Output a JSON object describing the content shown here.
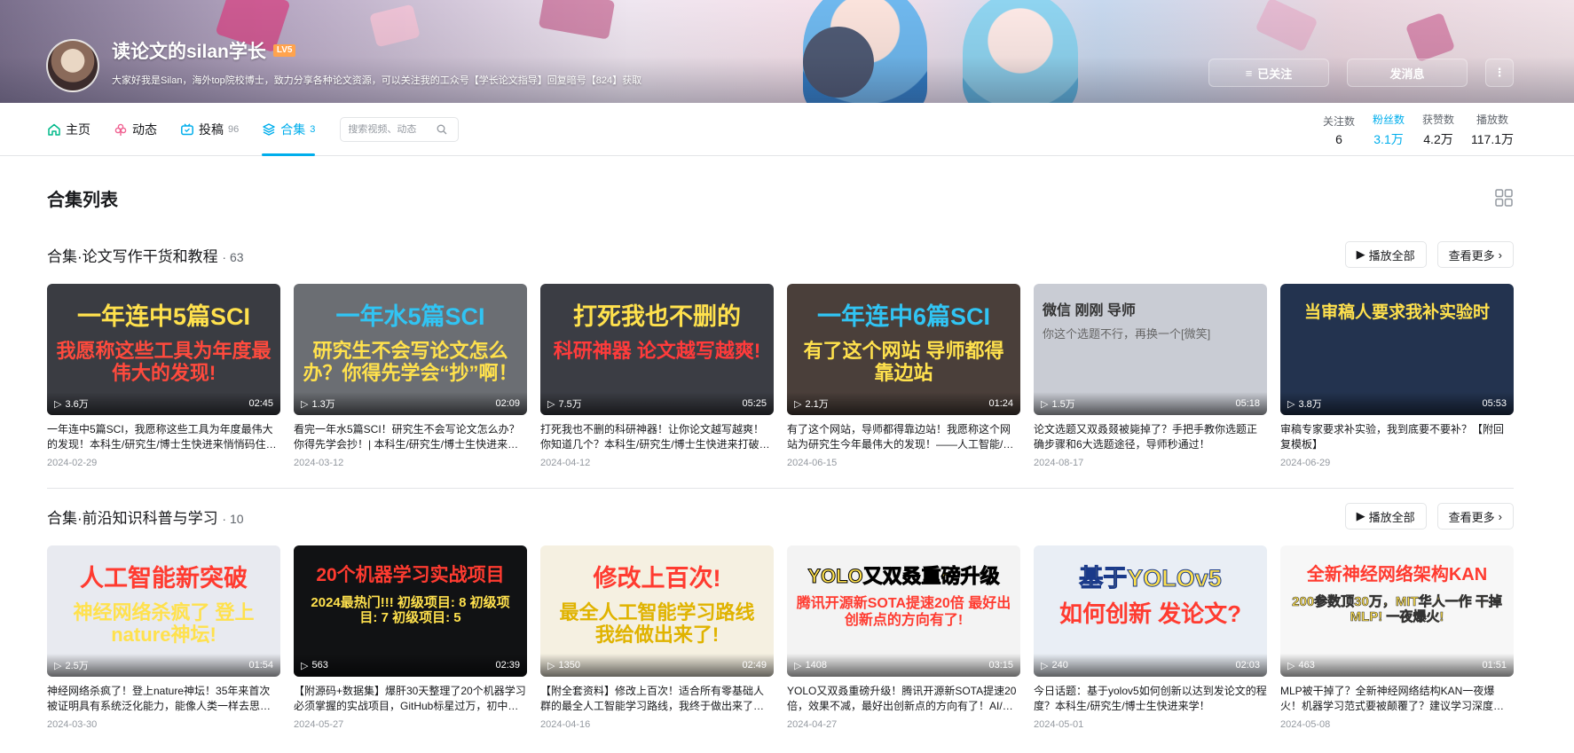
{
  "header": {
    "username": "读论文的silan学长",
    "level": "LV5",
    "signature": "大家好我是Silan，海外top院校博士，致力分享各种论文资源，可以关注我的工众号【学长论文指导】回复暗号【824】获取",
    "follow_button": "已关注",
    "message_button": "发消息"
  },
  "nav": {
    "tabs": [
      {
        "label": "主页",
        "count": "",
        "icon": "home-icon"
      },
      {
        "label": "动态",
        "count": "",
        "icon": "flower-icon"
      },
      {
        "label": "投稿",
        "count": "96",
        "icon": "tv-icon"
      },
      {
        "label": "合集",
        "count": "3",
        "icon": "layers-icon"
      }
    ],
    "search_placeholder": "搜索视频、动态"
  },
  "stats": [
    {
      "label": "关注数",
      "value": "6"
    },
    {
      "label": "粉丝数",
      "value": "3.1万"
    },
    {
      "label": "获赞数",
      "value": "4.2万"
    },
    {
      "label": "播放数",
      "value": "117.1万"
    }
  ],
  "list_title": "合集列表",
  "buttons": {
    "play_all": "播放全部",
    "see_more": "查看更多"
  },
  "sections": [
    {
      "title": "合集·论文写作干货和教程",
      "count": "· 63",
      "cards": [
        {
          "thumb_l1": "一年连中5篇SCI",
          "thumb_l2": "我愿称这些工具为年度最伟大的发现!",
          "bg": "#3a3c42",
          "c1": "#ffe14d",
          "c2": "#ff4a3d",
          "plays": "3.6万",
          "duration": "02:45",
          "title": "一年连中5篇SCI，我愿称这些工具为年度最伟大的发现！本科生/研究生/博士生快进来悄悄码住带走！",
          "date": "2024-02-29"
        },
        {
          "thumb_l1": "一年水5篇SCI",
          "thumb_l2": "研究生不会写论文怎么办？你得先学会“抄”啊！",
          "bg": "#6b6e73",
          "c1": "#31c4f3",
          "c2": "#ffe14d",
          "plays": "1.3万",
          "duration": "02:09",
          "title": "看完一年水5篇SCI！研究生不会写论文怎么办？你得先学会抄！| 本科生/研究生/博士生快进来学！",
          "date": "2024-03-12"
        },
        {
          "thumb_l1": "打死我也不删的",
          "thumb_l2": "科研神器 论文越写越爽!",
          "bg": "#3b3d44",
          "c1": "#ffe14d",
          "c2": "#ff3b3b",
          "plays": "7.5万",
          "duration": "05:25",
          "title": "打死我也不删的科研神器！让你论文越写越爽！你知道几个？本科生/研究生/博士生快进来打破信息差！",
          "date": "2024-04-12"
        },
        {
          "thumb_l1": "一年连中6篇SCI",
          "thumb_l2": "有了这个网站 导师都得靠边站",
          "bg": "#4a3f3a",
          "c1": "#31c4f3",
          "c2": "#ffe14d",
          "plays": "2.1万",
          "duration": "01:24",
          "title": "有了这个网站，导师都得靠边站！我愿称这个网站为研究生今年最伟大的发现！——人工智能/机器学习/深度学习",
          "date": "2024-06-15"
        },
        {
          "thumb_l1": "微信 刚刚  导师",
          "thumb_l2": "你这个选题不行，再换一个[微笑]",
          "bg": "#c9ccd4",
          "c1": "#333333",
          "c2": "#666666",
          "plays": "1.5万",
          "duration": "05:18",
          "title": "论文选题又双叒叕被毙掉了？手把手教你选题正确步骤和6大选题途径，导师秒通过！",
          "date": "2024-08-17"
        },
        {
          "thumb_l1": "当审稿人要求我补实验时",
          "thumb_l2": "",
          "bg": "#23334f",
          "c1": "#ffe14d",
          "c2": "#ffffff",
          "plays": "3.8万",
          "duration": "05:53",
          "title": "审稿专家要求补实验，我到底要不要补？【附回复模板】",
          "date": "2024-06-29"
        }
      ]
    },
    {
      "title": "合集·前沿知识科普与学习",
      "count": "· 10",
      "cards": [
        {
          "thumb_l1": "人工智能新突破",
          "thumb_l2": "神经网络杀疯了 登上nature神坛!",
          "bg": "#e8eaf0",
          "c1": "#ff3b30",
          "c2": "#ffe14d",
          "plays": "2.5万",
          "duration": "01:54",
          "title": "神经网络杀疯了！登上nature神坛！35年来首次被证明具有系统泛化能力，能像人类一样去思考，AI又一次新的突破！",
          "date": "2024-03-30"
        },
        {
          "thumb_l1": "20个机器学习实战项目",
          "thumb_l2": "2024最热门!!! 初级项目: 8 初级项目: 7 初级项目: 5",
          "bg": "#111214",
          "c1": "#ff3b30",
          "c2": "#ffe14d",
          "plays": "563",
          "duration": "02:39",
          "title": "【附源码+数据集】爆肝30天整理了20个机器学习必须掌握的实战项目，GitHub标星过万，初中高级均有！",
          "date": "2024-05-27"
        },
        {
          "thumb_l1": "修改上百次!",
          "thumb_l2": "最全人工智能学习路线 我给做出来了!",
          "bg": "#f5f0e1",
          "c1": "#ff3b30",
          "c2": "#e0b300",
          "plays": "1350",
          "duration": "02:49",
          "title": "【附全套资料】修改上百次！适合所有零基础人群的最全人工智能学习路线，我终于做出来了！-人工智能/机器学习/深度学习",
          "date": "2024-04-16"
        },
        {
          "thumb_l1": "YOLO又双叒重磅升级",
          "thumb_l2": "腾讯开源新SOTA提速20倍 最好出创新点的方向有了!",
          "bg": "#f3f3f3",
          "c1": "#ffe14d",
          "c2": "#ff3b30",
          "plays": "1408",
          "duration": "03:15",
          "title": "YOLO又双叒重磅升级！腾讯开源新SOTA提速20倍，效果不减，最好出创新点的方向有了！AI/人工智能/深度学习",
          "date": "2024-04-27"
        },
        {
          "thumb_l1": "基于YOLOv5",
          "thumb_l2": "如何创新 发论文?",
          "bg": "#e9eef5",
          "c1": "#ffe14d",
          "c2": "#ff3b30",
          "plays": "240",
          "duration": "02:03",
          "title": "今日话题：基于yolov5如何创新以达到发论文的程度？本科生/研究生/博士生快进来学！",
          "date": "2024-05-01"
        },
        {
          "thumb_l1": "全新神经网络架构KAN",
          "thumb_l2": "200参数顶30万，MIT华人一作 干掉MLP! 一夜爆火!",
          "bg": "#f7f7f7",
          "c1": "#ff3b30",
          "c2": "#ffe14d",
          "plays": "463",
          "duration": "01:51",
          "title": "MLP被干掉了？全新神经网络结构KAN一夜爆火！机器学习范式要被颠覆了？建议学习深度学习神经网络的都好好看看！",
          "date": "2024-05-08"
        }
      ]
    }
  ]
}
